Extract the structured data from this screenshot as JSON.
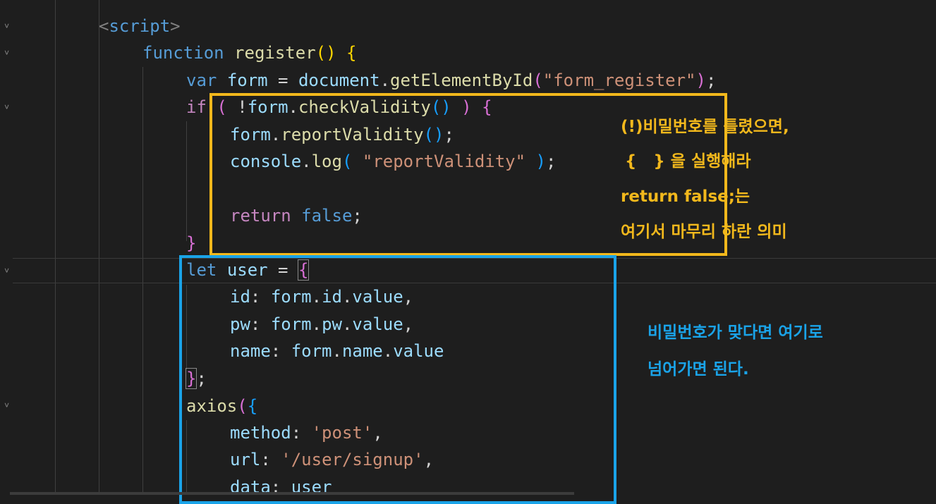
{
  "code": {
    "l1": {
      "lt": "<",
      "tag": "script",
      "gt": ">"
    },
    "l2": {
      "kw": "function",
      "fn": "register",
      "parens": "()",
      "brace": "{"
    },
    "l3": {
      "kw": "var",
      "v1": "form",
      "eq": " = ",
      "obj": "document",
      "dot": ".",
      "fn": "getElementById",
      "po": "(",
      "str": "\"form_register\"",
      "pc": ")",
      "semi": ";"
    },
    "l4": {
      "kw": "if",
      "po": "(",
      "not": " !",
      "obj": "form",
      "dot": ".",
      "fn": "checkValidity",
      "inner": "()",
      "pc": ")",
      "brace": "{"
    },
    "l5": {
      "obj": "form",
      "dot": ".",
      "fn": "reportValidity",
      "parens": "()",
      "semi": ";"
    },
    "l6": {
      "obj": "console",
      "dot": ".",
      "fn": "log",
      "po": "(",
      "str": "\"reportValidity\"",
      "pc": ")",
      "semi": ";"
    },
    "l8": {
      "kw": "return",
      "val": "false",
      "semi": ";"
    },
    "l9": {
      "brace": "}"
    },
    "l10": {
      "kw": "let",
      "v1": "user",
      "eq": " = ",
      "brace": "{"
    },
    "l11": {
      "key": "id",
      "colon": ": ",
      "v1": "form",
      "d1": ".",
      "v2": "id",
      "d2": ".",
      "v3": "value",
      "comma": ","
    },
    "l12": {
      "key": "pw",
      "colon": ": ",
      "v1": "form",
      "d1": ".",
      "v2": "pw",
      "d2": ".",
      "v3": "value",
      "comma": ","
    },
    "l13": {
      "key": "name",
      "colon": ": ",
      "v1": "form",
      "d1": ".",
      "v2": "name",
      "d2": ".",
      "v3": "value"
    },
    "l14": {
      "brace": "}",
      "semi": ";"
    },
    "l15": {
      "fn": "axios",
      "po": "(",
      "brace": "{"
    },
    "l16": {
      "key": "method",
      "colon": ": ",
      "str": "'post'",
      "comma": ","
    },
    "l17": {
      "key": "url",
      "colon": ": ",
      "str": "'/user/signup'",
      "comma": ","
    },
    "l18": {
      "key": "data",
      "colon": ": ",
      "v1": "user"
    }
  },
  "annotations": {
    "yellow": [
      "(!)비밀번호를 틀렸으면,",
      "{   } 을 실행해라",
      "return false;는",
      "여기서 마무리 하란 의미"
    ],
    "blue": [
      "비밀번호가 맞다면 여기로",
      "넘어가면 된다."
    ]
  },
  "colors": {
    "yellow_box": "#f2b81c",
    "blue_box": "#1aa3e8"
  }
}
